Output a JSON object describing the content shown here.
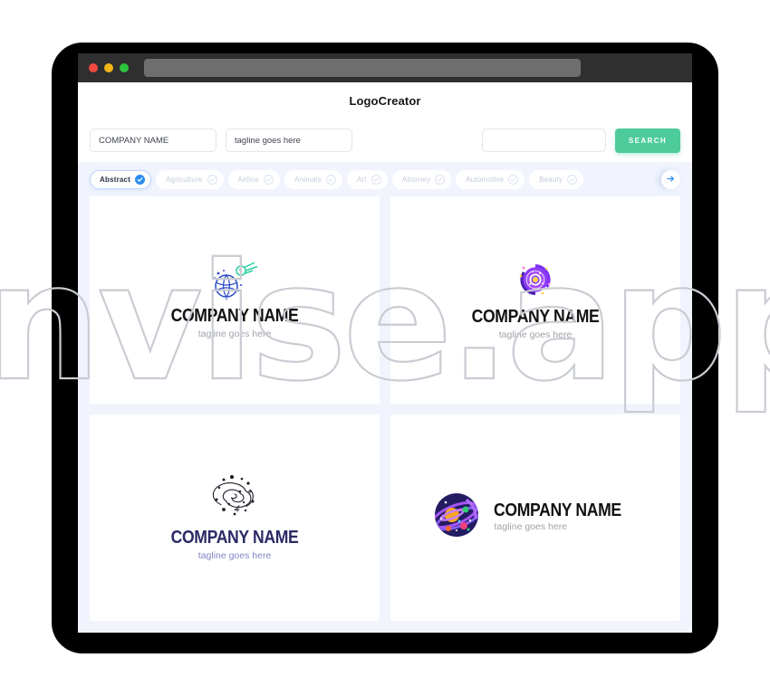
{
  "window": {
    "traffic_lights": [
      "close-red",
      "minimize-yellow",
      "maximize-green"
    ],
    "url_bar_value": ""
  },
  "header": {
    "app_title": "LogoCreator"
  },
  "search": {
    "company_value": "COMPANY NAME",
    "company_placeholder": "COMPANY NAME",
    "tagline_value": "tagline goes here",
    "tagline_placeholder": "tagline goes here",
    "keyword_value": "",
    "keyword_placeholder": "",
    "search_button_label": "SEARCH",
    "search_button_color": "#4ecb9b"
  },
  "filters": {
    "active_color": "#2b8cf0",
    "chips": [
      {
        "label": "Abstract",
        "active": true
      },
      {
        "label": "Agriculture",
        "active": false
      },
      {
        "label": "Airline",
        "active": false
      },
      {
        "label": "Animals",
        "active": false
      },
      {
        "label": "Art",
        "active": false
      },
      {
        "label": "Attorney",
        "active": false
      },
      {
        "label": "Automotive",
        "active": false
      },
      {
        "label": "Beauty",
        "active": false
      }
    ],
    "next_arrow": "arrow-right-icon"
  },
  "cards": [
    {
      "icon": "globe-comet-icon",
      "layout": "stacked",
      "name": "COMPANY NAME",
      "tagline": "tagline goes here",
      "name_color": "#121212",
      "tagline_color": "#9fa3ab"
    },
    {
      "icon": "spiral-galaxy-purple-icon",
      "layout": "stacked",
      "name": "COMPANY NAME",
      "tagline": "tagline goes here",
      "name_color": "#121212",
      "tagline_color": "#9fa3ab"
    },
    {
      "icon": "spiral-galaxy-line-icon",
      "layout": "stacked",
      "name": "COMPANY NAME",
      "tagline": "tagline goes here",
      "name_color": "#2b2a66",
      "tagline_color": "#8286c4"
    },
    {
      "icon": "planet-orbit-icon",
      "layout": "side-by-side",
      "name": "COMPANY NAME",
      "tagline": "tagline goes here",
      "name_color": "#121212",
      "tagline_color": "#9fa3ab"
    }
  ],
  "watermark": {
    "text": "invise.app"
  }
}
